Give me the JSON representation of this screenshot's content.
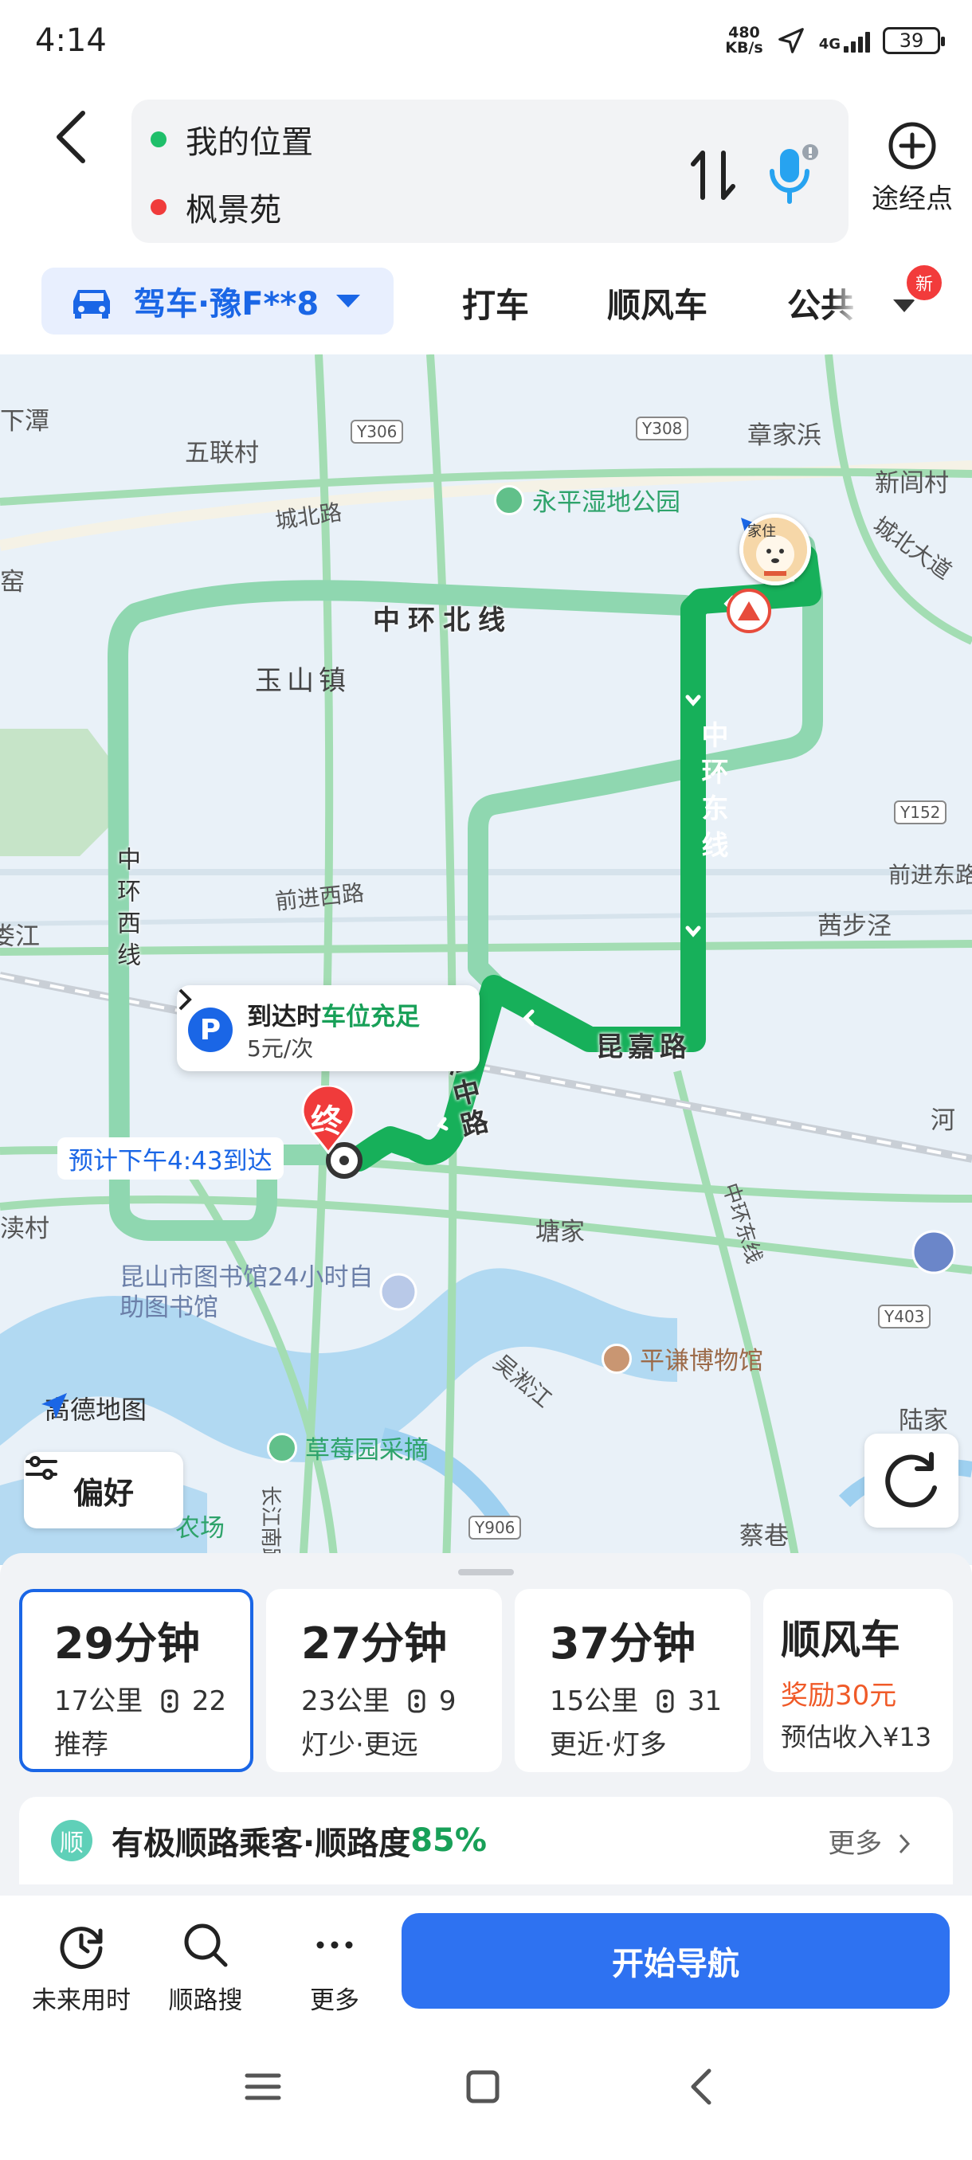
{
  "status_bar": {
    "time": "4:14",
    "net_speed_value": "480",
    "net_speed_unit": "KB/s",
    "network": "4G",
    "battery": "39"
  },
  "header": {
    "start_location": "我的位置",
    "end_location": "枫景苑",
    "waypoint_label": "途经点"
  },
  "modes": {
    "drive_label": "驾车·豫F**8",
    "taxi": "打车",
    "carpool": "顺风车",
    "transit": "公共",
    "new_badge": "新"
  },
  "map": {
    "places": [
      {
        "id": "xiatan",
        "text": "下潭"
      },
      {
        "id": "wulian",
        "text": "五联村"
      },
      {
        "id": "zhangjiabang",
        "text": "章家浜"
      },
      {
        "id": "xinwen",
        "text": "新闾村"
      },
      {
        "id": "yao",
        "text": "窑"
      },
      {
        "id": "yushan",
        "text": "玉山镇"
      },
      {
        "id": "xibuzhen",
        "text": "茜步泾"
      },
      {
        "id": "jiang",
        "text": "娄江"
      },
      {
        "id": "tangjia",
        "text": "塘家"
      },
      {
        "id": "dushu",
        "text": "渎村"
      },
      {
        "id": "lujia",
        "text": "陆家"
      },
      {
        "id": "caixiang",
        "text": "蔡巷"
      },
      {
        "id": "he",
        "text": "河"
      }
    ],
    "roads": {
      "chengbei": "城北路",
      "chengbei_ave": "城北大道",
      "qianjin_w": "前进西路",
      "qianjin_e": "前进东路",
      "wusongjiang": "吴淞江",
      "changjiang_s": "长江南路",
      "zhonghuan_east_lower": "中环东线"
    },
    "shields": {
      "y306": "Y306",
      "y308": "Y308",
      "y152": "Y152",
      "y403": "Y403",
      "y906": "Y906"
    },
    "route_labels": {
      "north": "中环北线",
      "east": "中环东线",
      "west": "中环西线",
      "kunjia": "昆嘉路",
      "changjiang": "长江中路"
    },
    "pois": {
      "wetland": "永平湿地公园",
      "library": "昆山市图书馆24小时自助图书馆",
      "museum": "平谦博物馆",
      "strawberry": "草莓园采摘",
      "farm": "农场"
    },
    "parking": {
      "title_prefix": "到达时",
      "title_highlight": "车位充足",
      "price": "5元/次"
    },
    "eta": "预计下午4:43到达",
    "end_marker": "终",
    "start_tag": "家住",
    "logo": "高德地图",
    "preference": "偏好"
  },
  "routes": [
    {
      "time": "29分钟",
      "distance": "17公里",
      "lights": "22",
      "tag": "推荐"
    },
    {
      "time": "27分钟",
      "distance": "23公里",
      "lights": "9",
      "tag": "灯少·更远"
    },
    {
      "time": "37分钟",
      "distance": "15公里",
      "lights": "31",
      "tag": "更近·灯多"
    }
  ],
  "carpool_card": {
    "title": "顺风车",
    "reward": "奖励30元",
    "income": "预估收入¥13"
  },
  "shunlu": {
    "icon": "顺",
    "text": "有极顺路乘客·顺路度",
    "percent": "85%",
    "more": "更多"
  },
  "actions": {
    "future_time": "未来用时",
    "search_along": "顺路搜",
    "more": "更多",
    "start_navigation": "开始导航"
  },
  "colors": {
    "accent": "#1a66e6",
    "route_main": "#17b05a",
    "route_alt": "#8fd7b0",
    "reward": "#f05a28"
  }
}
